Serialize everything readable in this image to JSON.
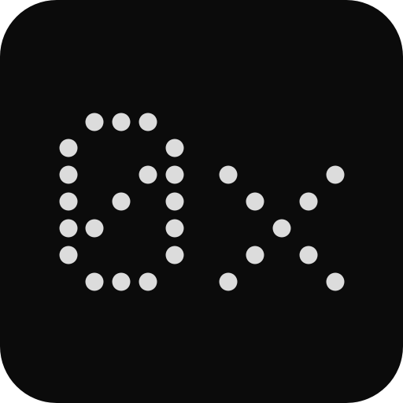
{
  "icon": {
    "name": "0x-dot-matrix-app-icon",
    "glyphs": [
      "0",
      "x"
    ],
    "background_color": "#0b0b0b",
    "dot_color": "#dcdcdc"
  }
}
